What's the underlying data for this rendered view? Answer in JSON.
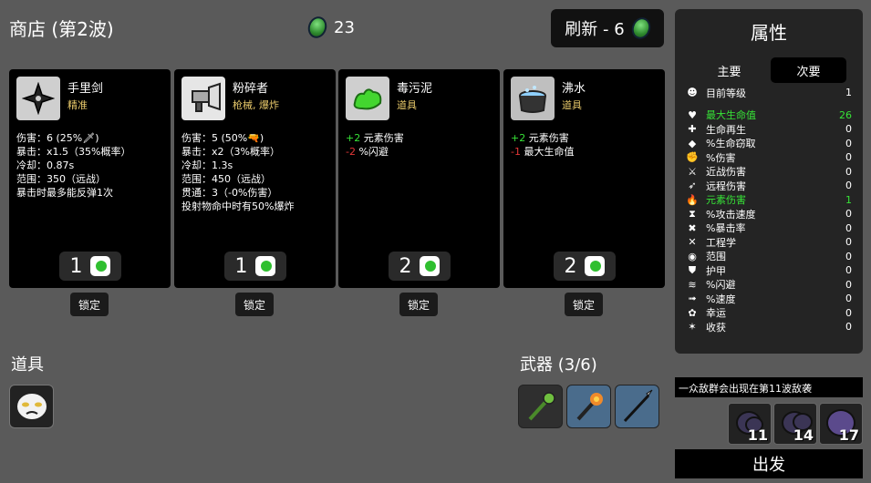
{
  "shop": {
    "title": "商店 (第2波)",
    "materials": "23",
    "refresh_label": "刷新 - 6"
  },
  "cards": [
    {
      "name": "手里剑",
      "type": "精准",
      "stats": [
        "伤害：6 (25%🗡)",
        "暴击：x1.5（35%概率）",
        "冷却：0.87s",
        "范围：350（远战）",
        "暴击时最多能反弹1次"
      ],
      "price": "1",
      "lock": "锁定"
    },
    {
      "name": "粉碎者",
      "type": "枪械, 爆炸",
      "stats": [
        "伤害：5 (50%🔫)",
        "暴击：x2（3%概率）",
        "冷却：1.3s",
        "范围：450（远战）",
        "贯通：3（-0%伤害）",
        "投射物命中时有50%爆炸"
      ],
      "price": "1",
      "lock": "锁定"
    },
    {
      "name": "毒污泥",
      "type": "道具",
      "stats_mod": [
        {
          "v": "+2",
          "t": "元素伤害",
          "c": "g"
        },
        {
          "v": "-2",
          "t": "%闪避",
          "c": "r"
        }
      ],
      "price": "2",
      "lock": "锁定"
    },
    {
      "name": "沸水",
      "type": "道具",
      "stats_mod": [
        {
          "v": "+2",
          "t": "元素伤害",
          "c": "g"
        },
        {
          "v": "-1",
          "t": "最大生命值",
          "c": "r"
        }
      ],
      "price": "2",
      "lock": "锁定"
    }
  ],
  "items_title": "道具",
  "weapons_title": "武器 (3/6)",
  "attributes": {
    "title": "属性",
    "tabs": [
      "主要",
      "次要"
    ],
    "rows": [
      {
        "icon": "level-icon",
        "glyph": "☻",
        "label": "目前等级",
        "value": "1",
        "green": false
      },
      {
        "icon": "heart-icon",
        "glyph": "♥",
        "label": "最大生命值",
        "value": "26",
        "green": true
      },
      {
        "icon": "regen-icon",
        "glyph": "✚",
        "label": "生命再生",
        "value": "0",
        "green": false
      },
      {
        "icon": "lifesteal-icon",
        "glyph": "◆",
        "label": "%生命窃取",
        "value": "0",
        "green": false
      },
      {
        "icon": "damage-icon",
        "glyph": "✊",
        "label": "%伤害",
        "value": "0",
        "green": false
      },
      {
        "icon": "melee-icon",
        "glyph": "⚔",
        "label": "近战伤害",
        "value": "0",
        "green": false
      },
      {
        "icon": "ranged-icon",
        "glyph": "➶",
        "label": "远程伤害",
        "value": "0",
        "green": false
      },
      {
        "icon": "elemental-icon",
        "glyph": "🔥",
        "label": "元素伤害",
        "value": "1",
        "green": true
      },
      {
        "icon": "attack-speed-icon",
        "glyph": "⧗",
        "label": "%攻击速度",
        "value": "0",
        "green": false
      },
      {
        "icon": "crit-icon",
        "glyph": "✖",
        "label": "%暴击率",
        "value": "0",
        "green": false
      },
      {
        "icon": "engineering-icon",
        "glyph": "✕",
        "label": "工程学",
        "value": "0",
        "green": false
      },
      {
        "icon": "range-icon",
        "glyph": "◉",
        "label": "范围",
        "value": "0",
        "green": false
      },
      {
        "icon": "armor-icon",
        "glyph": "⛊",
        "label": "护甲",
        "value": "0",
        "green": false
      },
      {
        "icon": "dodge-icon",
        "glyph": "≋",
        "label": "%闪避",
        "value": "0",
        "green": false
      },
      {
        "icon": "speed-icon",
        "glyph": "➟",
        "label": "%速度",
        "value": "0",
        "green": false
      },
      {
        "icon": "luck-icon",
        "glyph": "✿",
        "label": "幸运",
        "value": "0",
        "green": false
      },
      {
        "icon": "harvest-icon",
        "glyph": "✶",
        "label": "收获",
        "value": "0",
        "green": false
      }
    ]
  },
  "wave_warning": "一众敌群会出现在第11波敌袭",
  "enemies": [
    "11",
    "14",
    "17"
  ],
  "go_label": "出发",
  "colors": {
    "accent_green": "#37e337",
    "warn_red": "#e33737",
    "type_yellow": "#e8c96a"
  }
}
